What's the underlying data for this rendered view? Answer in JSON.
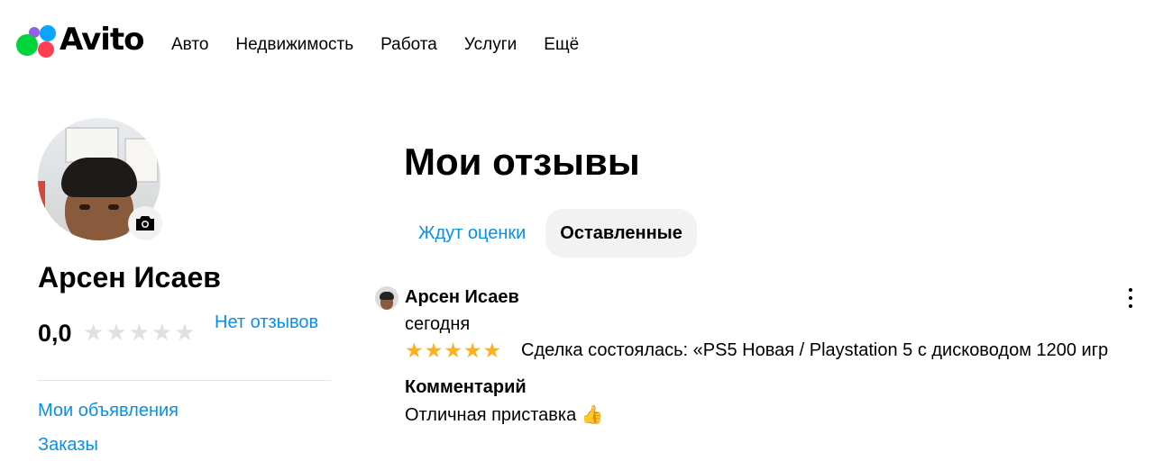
{
  "header": {
    "logo_text": "Avito",
    "nav": [
      "Авто",
      "Недвижимость",
      "Работа",
      "Услуги",
      "Ещё"
    ]
  },
  "profile": {
    "name": "Арсен Исаев",
    "rating_value": "0,0",
    "rating_stars": 0,
    "rating_max": 5,
    "no_reviews_label": "Нет отзывов",
    "links": [
      "Мои объявления",
      "Заказы"
    ]
  },
  "main": {
    "title": "Мои отзывы",
    "tabs": [
      {
        "label": "Ждут оценки",
        "active": false
      },
      {
        "label": "Оставленные",
        "active": true
      }
    ],
    "review": {
      "author": "Арсен Исаев",
      "date": "сегодня",
      "stars": 5,
      "deal": "Сделка состоялась: «PS5 Новая / Playstation 5 с дисководом 1200 игр",
      "comment_label": "Комментарий",
      "comment": "Отличная приставка 👍"
    }
  },
  "colors": {
    "link": "#0a8fe6",
    "star_full": "#ffb021",
    "star_empty": "#e0e0e0",
    "tab_active_bg": "#f2f2f2"
  },
  "icons": {
    "camera": "camera-icon",
    "more": "more-vertical-icon",
    "thumbs_up": "thumbs-up-icon"
  }
}
